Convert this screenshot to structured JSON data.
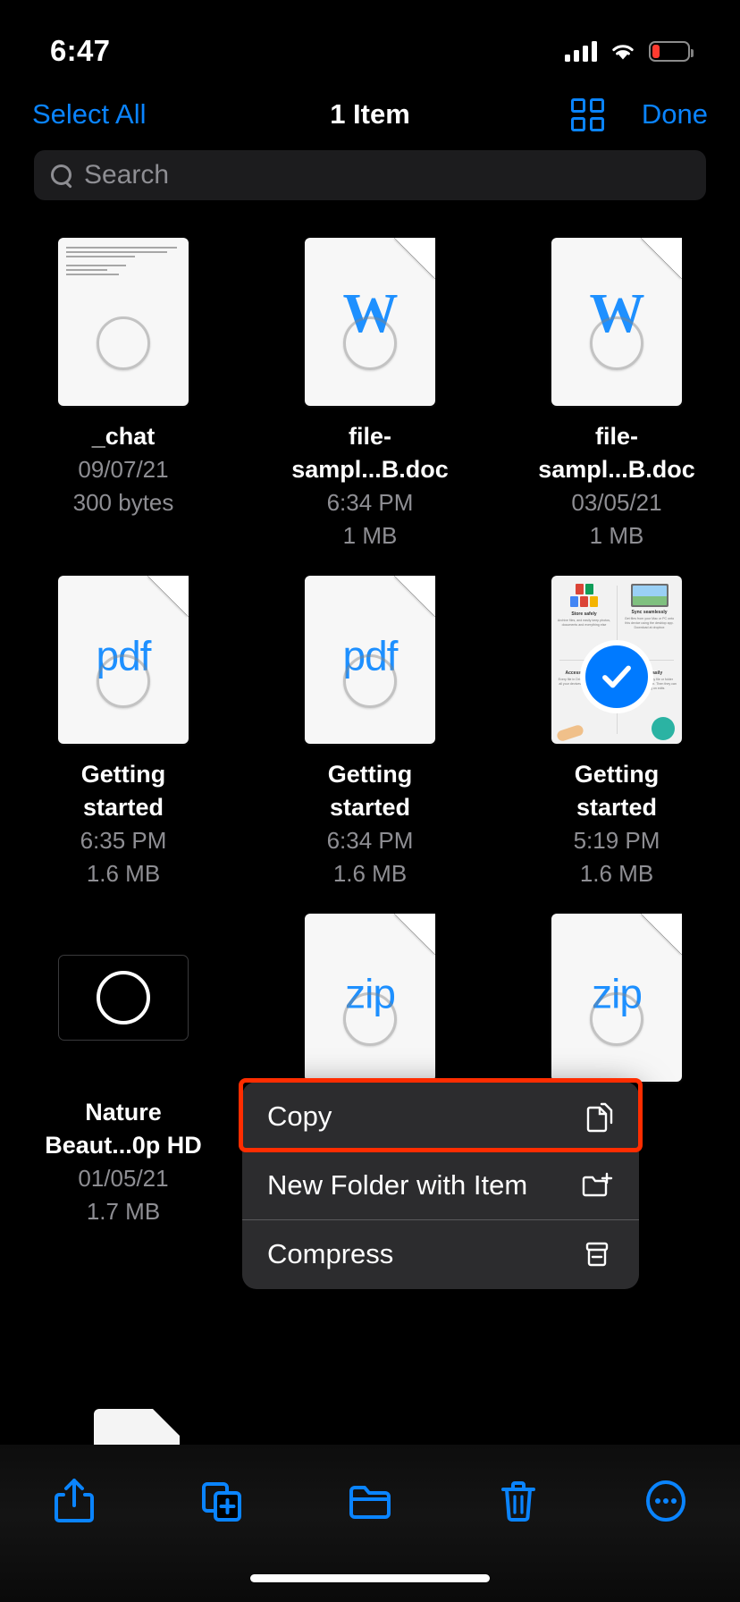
{
  "status_bar": {
    "time": "6:47",
    "cellular_icon": "signal-bars-icon",
    "wifi_icon": "wifi-icon",
    "battery_icon": "battery-low-icon",
    "battery_color": "#ff3b30"
  },
  "nav_bar": {
    "select_all_label": "Select All",
    "title": "1 Item",
    "view_toggle_icon": "grid-view-icon",
    "done_label": "Done",
    "accent_color": "#0a84ff"
  },
  "search": {
    "placeholder": "Search",
    "icon": "search-icon"
  },
  "files": [
    {
      "name": "_chat",
      "date": "09/07/21",
      "size": "300 bytes",
      "thumb": "text-document",
      "selected": false
    },
    {
      "name": "file-sampl...B.doc",
      "date": "6:34 PM",
      "size": "1 MB",
      "thumb": "word-document",
      "selected": false
    },
    {
      "name": "file-sampl...B.doc",
      "date": "03/05/21",
      "size": "1 MB",
      "thumb": "word-document",
      "selected": false
    },
    {
      "name": "Getting started",
      "date": "6:35 PM",
      "size": "1.6 MB",
      "thumb": "pdf-document",
      "selected": false
    },
    {
      "name": "Getting started",
      "date": "6:34 PM",
      "size": "1.6 MB",
      "thumb": "pdf-document",
      "selected": false
    },
    {
      "name": "Getting started",
      "date": "5:19 PM",
      "size": "1.6 MB",
      "thumb": "pdf-preview",
      "selected": true
    },
    {
      "name": "Nature Beaut...0p HD",
      "date": "01/05/21",
      "size": "1.7 MB",
      "thumb": "video-black",
      "selected": false
    },
    {
      "name": "",
      "date": "",
      "size": "",
      "thumb": "zip-document",
      "selected": false
    },
    {
      "name": "",
      "date": "",
      "size": "",
      "thumb": "zip-document",
      "selected": false
    }
  ],
  "doc_preview_text": {
    "quadrants": [
      {
        "title": "Store safely",
        "body": "Archive files, and easily keep photos, documents and everything else"
      },
      {
        "title": "Sync seamlessly",
        "body": "Get files from your Mac or PC onto this device using the desktop app. Download at dropbox"
      },
      {
        "title": "Access anywhere",
        "body": "Every file in Drive lands available on all your devices wherever you need"
      },
      {
        "title": "Share easily",
        "body": "Share anyone to any file or folder using the Share button. Then they can start working on edits"
      }
    ]
  },
  "context_menu": {
    "highlight_color": "#ff2d00",
    "items": [
      {
        "label": "Copy",
        "icon": "copy-icon",
        "highlighted": true
      },
      {
        "label": "New Folder with Item",
        "icon": "new-folder-icon",
        "highlighted": false
      },
      {
        "label": "Compress",
        "icon": "compress-icon",
        "highlighted": false
      }
    ]
  },
  "toolbar": {
    "accent_color": "#0a84ff",
    "buttons": [
      {
        "name": "share-icon",
        "label": "Share"
      },
      {
        "name": "duplicate-icon",
        "label": "Duplicate"
      },
      {
        "name": "move-to-folder-icon",
        "label": "Move"
      },
      {
        "name": "delete-icon",
        "label": "Delete"
      },
      {
        "name": "more-options-icon",
        "label": "More"
      }
    ]
  }
}
